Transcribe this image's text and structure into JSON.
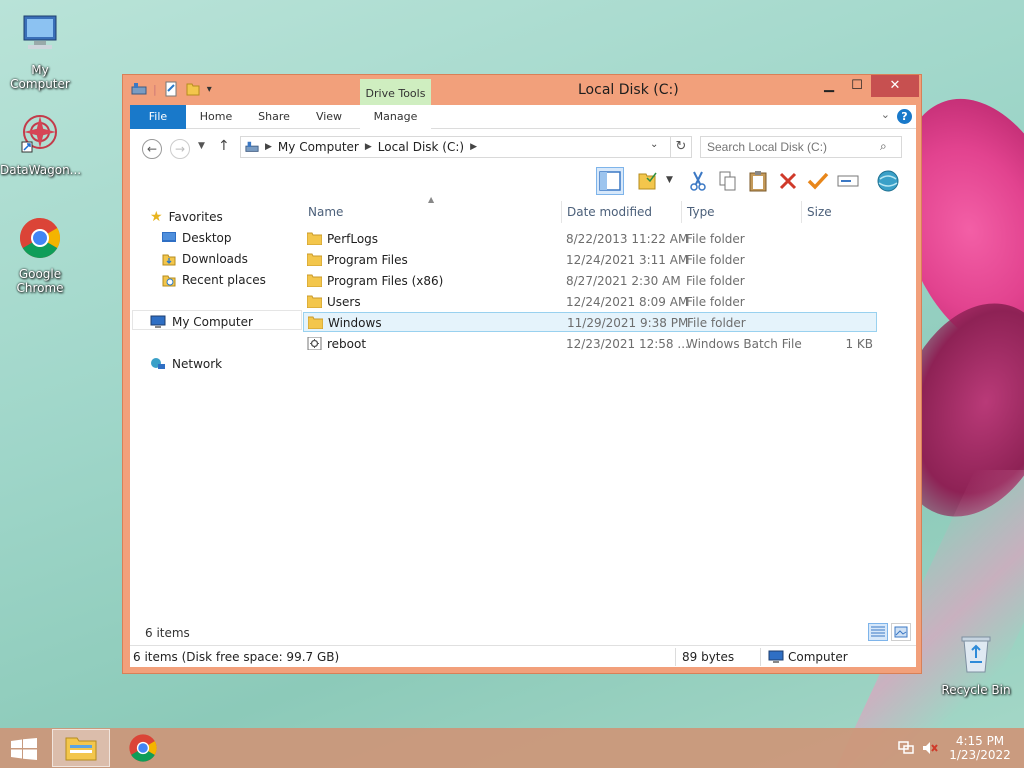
{
  "desktop": {
    "icons": [
      {
        "label": "My Computer"
      },
      {
        "label": "DataWagon..."
      },
      {
        "label": "Google Chrome"
      },
      {
        "label": "Recycle Bin"
      }
    ]
  },
  "window": {
    "title": "Local Disk (C:)",
    "contextual_tab_group": "Drive Tools",
    "ribbon_tabs": [
      "File",
      "Home",
      "Share",
      "View",
      "Manage"
    ],
    "help_label": "?"
  },
  "address": {
    "segments": [
      "My Computer",
      "Local Disk (C:)"
    ],
    "search_placeholder": "Search Local Disk (C:)"
  },
  "navigation": {
    "favorites_label": "Favorites",
    "favorites": [
      "Desktop",
      "Downloads",
      "Recent places"
    ],
    "computer_label": "My Computer",
    "network_label": "Network"
  },
  "columns": {
    "name": "Name",
    "date": "Date modified",
    "type": "Type",
    "size": "Size"
  },
  "files": [
    {
      "name": "PerfLogs",
      "date": "8/22/2013 11:22 AM",
      "type": "File folder",
      "size": "",
      "kind": "folder-icon"
    },
    {
      "name": "Program Files",
      "date": "12/24/2021 3:11 AM",
      "type": "File folder",
      "size": "",
      "kind": "folder-icon"
    },
    {
      "name": "Program Files (x86)",
      "date": "8/27/2021 2:30 AM",
      "type": "File folder",
      "size": "",
      "kind": "folder-icon"
    },
    {
      "name": "Users",
      "date": "12/24/2021 8:09 AM",
      "type": "File folder",
      "size": "",
      "kind": "folder-icon"
    },
    {
      "name": "Windows",
      "date": "11/29/2021 9:38 PM",
      "type": "File folder",
      "size": "",
      "kind": "folder-icon",
      "selected": true
    },
    {
      "name": "reboot",
      "date": "12/23/2021 12:58 ...",
      "type": "Windows Batch File",
      "size": "1 KB",
      "kind": "batch-file-icon"
    }
  ],
  "item_count": "6 items",
  "status": {
    "left": "6 items (Disk free space: 99.7 GB)",
    "middle": "89 bytes",
    "right": "Computer"
  },
  "clock": {
    "time": "4:15 PM",
    "date": "1/23/2022"
  },
  "colors": {
    "accent": "#1979ca",
    "window_frame": "#f2a07b",
    "selection": "#e5f3fb",
    "close_button": "#c75050"
  }
}
